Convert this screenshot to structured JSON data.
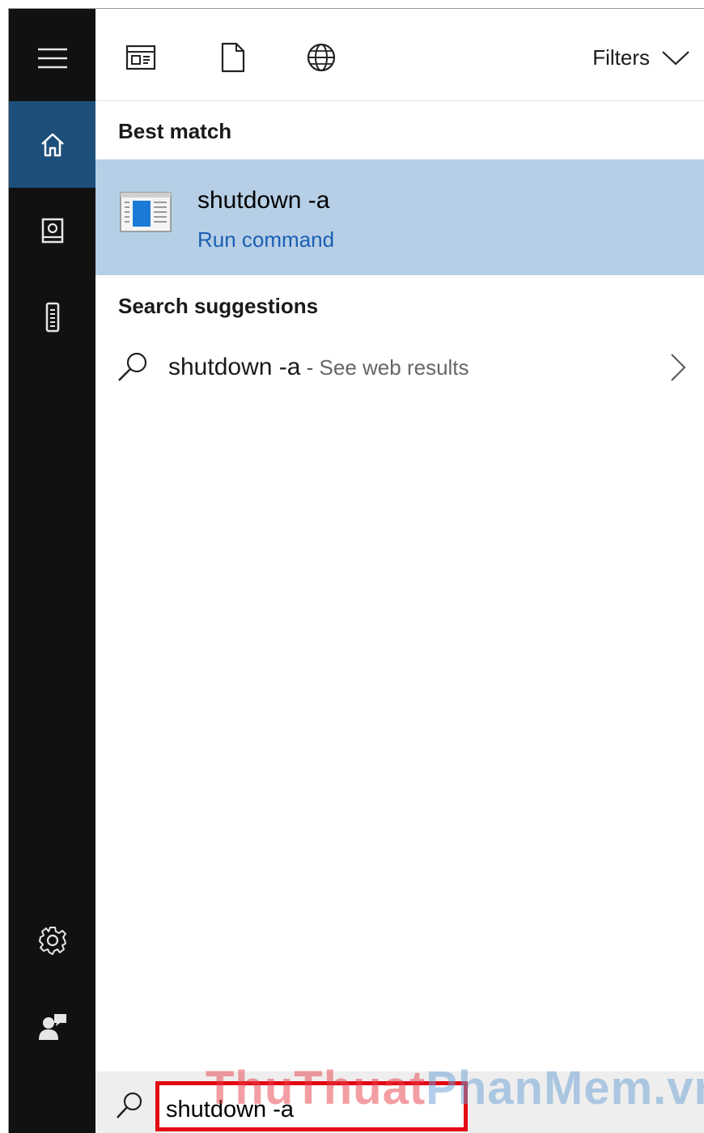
{
  "toolbar": {
    "icons": [
      "apps-icon",
      "documents-icon",
      "web-icon"
    ],
    "filters_label": "Filters"
  },
  "rail": {
    "items": [
      "menu-icon",
      "home-icon",
      "notebook-icon",
      "devices-icon",
      "settings-icon",
      "feedback-icon"
    ],
    "active": "home-icon"
  },
  "best_match": {
    "heading": "Best match",
    "title": "shutdown -a",
    "subtitle": "Run command"
  },
  "suggestions": {
    "heading": "Search suggestions",
    "items": [
      {
        "query": "shutdown -a",
        "separator": " - ",
        "hint": "See web results"
      }
    ]
  },
  "search": {
    "value": "shutdown -a"
  },
  "watermark": {
    "part1": "ThuThuat",
    "part2": "PhanMem.vn"
  },
  "colors": {
    "rail_bg": "#111111",
    "rail_active": "#1d4f7a",
    "highlight": "#b6cfe6",
    "link": "#1a5fb4",
    "search_border": "#e30613"
  }
}
